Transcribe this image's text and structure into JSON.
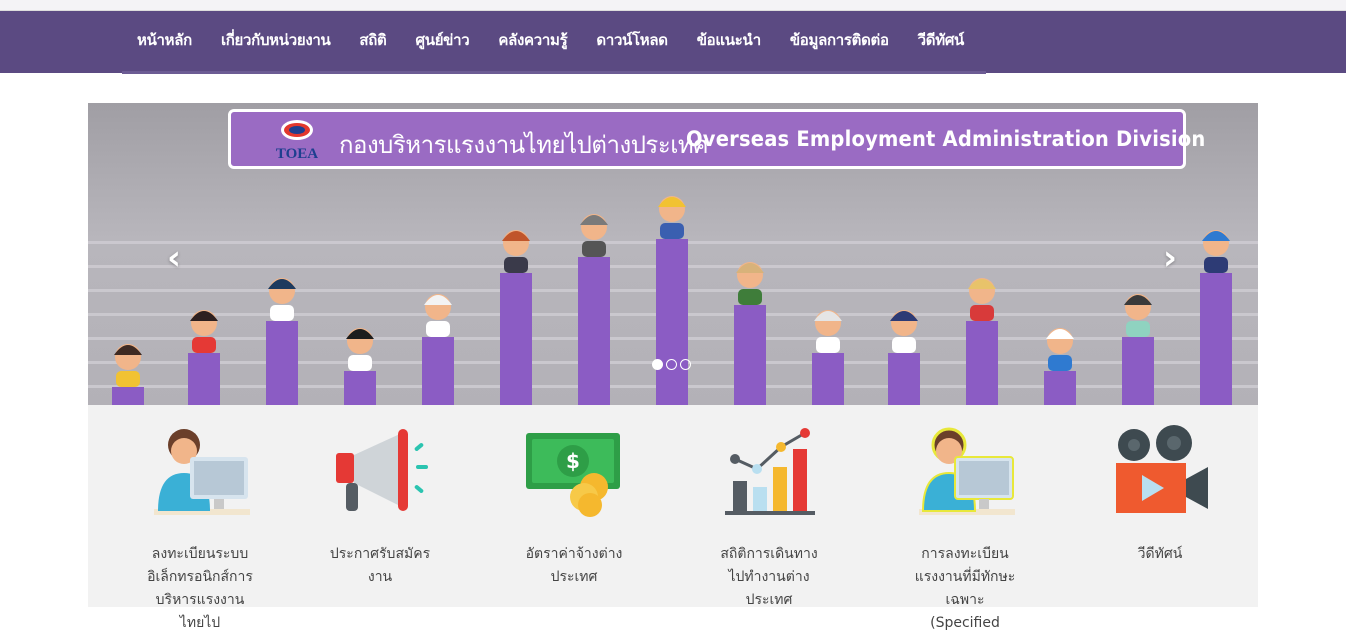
{
  "nav": {
    "items": [
      "หน้าหลัก",
      "เกี่ยวกับหน่วยงาน",
      "สถิติ",
      "ศูนย์ข่าว",
      "คลังความรู้",
      "ดาวน์โหลด",
      "ข้อแนะนำ",
      "ข้อมูลการติดต่อ",
      "วีดีทัศน์"
    ]
  },
  "slider": {
    "title_th": "กองบริหารแรงงานไทยไปต่างประเทศ",
    "title_en": "Overseas Employment Administration Division",
    "logo_text": "TOEA",
    "prev_label": "‹",
    "next_label": "›",
    "slide_count": 3,
    "active_slide": 1
  },
  "services": [
    {
      "label": "ลงทะเบียนระบบอิเล็กทรอนิกส์การบริหารแรงงานไทยไป",
      "icon": "computer-user-icon"
    },
    {
      "label": "ประกาศรับสมัครงาน",
      "icon": "megaphone-icon"
    },
    {
      "label": "อัตราค่าจ้างต่างประเทศ",
      "icon": "money-icon"
    },
    {
      "label": "สถิติการเดินทางไปทำงานต่างประเทศ",
      "icon": "bar-chart-icon"
    },
    {
      "label": "การลงทะเบียนแรงงานที่มีทักษะเฉพาะ (Specified",
      "icon": "computer-user-icon"
    },
    {
      "label": "วีดีทัศน์",
      "icon": "video-camera-icon"
    }
  ],
  "colors": {
    "nav_bg": "#5b4a82",
    "accent_purple": "#8b5cc4",
    "service_bg": "#f2f2f2"
  }
}
